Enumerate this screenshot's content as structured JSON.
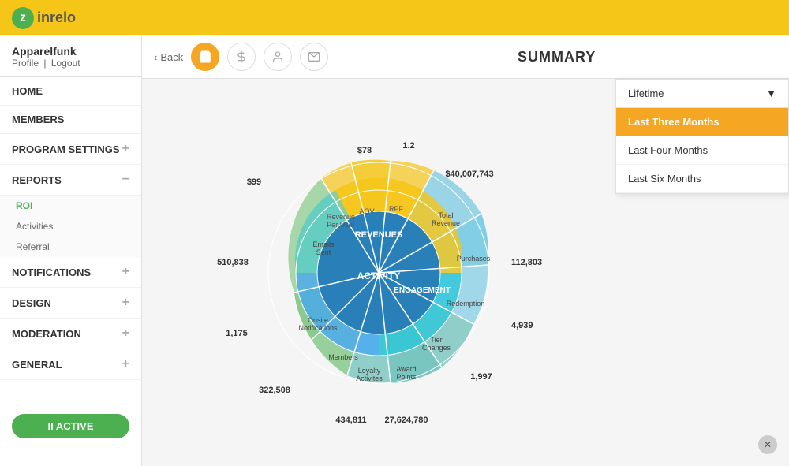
{
  "topbar": {
    "logo_letter": "z",
    "logo_text": "inrelo"
  },
  "sidebar": {
    "user_name": "Apparelfunk",
    "profile_label": "Profile",
    "logout_label": "Logout",
    "nav_items": [
      {
        "label": "HOME",
        "type": "plain"
      },
      {
        "label": "MEMBERS",
        "type": "plain"
      },
      {
        "label": "PROGRAM SETTINGS",
        "type": "plus"
      },
      {
        "label": "REPORTS",
        "type": "minus"
      },
      {
        "label": "NOTIFICATIONS",
        "type": "plus"
      },
      {
        "label": "DESIGN",
        "type": "plus"
      },
      {
        "label": "MODERATION",
        "type": "plus"
      },
      {
        "label": "GENERAL",
        "type": "plus"
      }
    ],
    "reports_sub": [
      {
        "label": "ROI",
        "active": true
      },
      {
        "label": "Activities",
        "active": false
      },
      {
        "label": "Referral",
        "active": false
      }
    ],
    "active_button": "II  ACTIVE"
  },
  "header": {
    "back_label": "Back",
    "summary_title": "SUMMARY",
    "icons": [
      "bag",
      "dollar",
      "person",
      "mail"
    ]
  },
  "dropdown": {
    "trigger_label": "Lifetime",
    "options": [
      {
        "label": "Last Three Months",
        "selected": true
      },
      {
        "label": "Last Four Months",
        "selected": false
      },
      {
        "label": "Last Six Months",
        "selected": false
      }
    ]
  },
  "chart": {
    "outer_values": {
      "aov": "$78",
      "rpf": "1.2",
      "total_revenue": "$40,007,743",
      "purchases": "112,803",
      "redemption_val": "4,939",
      "tier_changes": "1,997",
      "award_points": "27,624,780",
      "loyalty_activities": "434,811",
      "members_val": "322,508",
      "onsite_notif_val": "1,175",
      "emails_sent_val": "510,838",
      "revenue_per_user": "$99"
    },
    "center_labels": {
      "revenues": "REVENUES",
      "engagement": "ENGAGEMENT",
      "activity": "ACTIVITY"
    },
    "segment_labels": {
      "aov": "AOV",
      "rpf": "RPF",
      "total_revenue": "Total\nRevenue",
      "purchases": "Purchases",
      "redemption": "Redemption",
      "tier_changes": "Tier\nChanges",
      "award_points": "Award\nPoints",
      "loyalty_activities": "Loyalty\nActivites",
      "members": "Members",
      "onsite_notifications": "Onsite\nNotifications",
      "emails_sent": "Emails\nSent",
      "revenue_per_user": "Revenue\nPer User"
    }
  }
}
